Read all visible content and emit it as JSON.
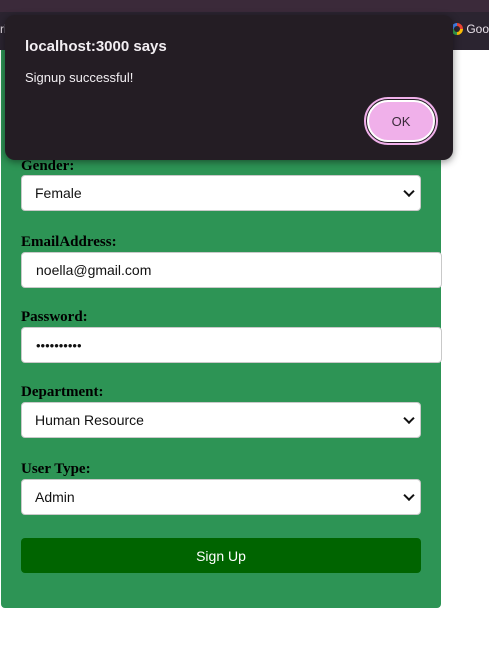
{
  "browser": {
    "bookmark_left": "ri",
    "bookmark_right": "Goo"
  },
  "form": {
    "gender": {
      "label": "Gender:",
      "value": "Female"
    },
    "email": {
      "label": "EmailAddress:",
      "value": "noella@gmail.com"
    },
    "password": {
      "label": "Password:",
      "masked_value": "••••••••••"
    },
    "department": {
      "label": "Department:",
      "value": "Human Resource"
    },
    "user_type": {
      "label": "User Type:",
      "value": "Admin"
    },
    "submit_label": "Sign Up"
  },
  "dialog": {
    "title": "localhost:3000 says",
    "message": "Signup successful!",
    "ok_label": "OK"
  },
  "colors": {
    "form_background": "#2d9455",
    "submit_button": "#006400",
    "dialog_background": "#241d24",
    "ok_button": "#f0b0ea"
  }
}
